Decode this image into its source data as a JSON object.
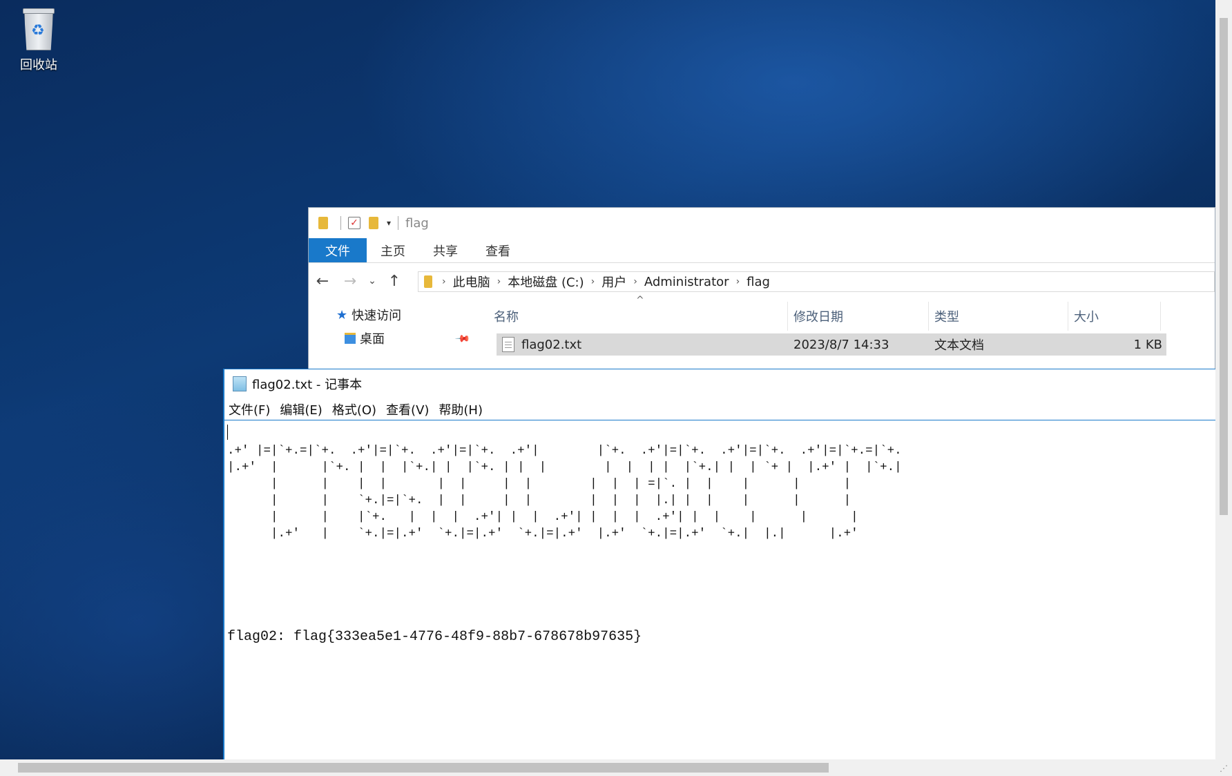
{
  "desktop": {
    "recycle_bin_label": "回收站"
  },
  "explorer": {
    "title": "flag",
    "ribbon_tabs": [
      "文件",
      "主页",
      "共享",
      "查看"
    ],
    "breadcrumb": [
      "此电脑",
      "本地磁盘 (C:)",
      "用户",
      "Administrator",
      "flag"
    ],
    "nav": {
      "quick_access": "快速访问",
      "desktop": "桌面"
    },
    "columns": [
      "名称",
      "修改日期",
      "类型",
      "大小"
    ],
    "files": [
      {
        "name": "flag02.txt",
        "modified": "2023/8/7 14:33",
        "type": "文本文档",
        "size": "1 KB"
      }
    ]
  },
  "notepad": {
    "title": "flag02.txt - 记事本",
    "menu": [
      "文件(F)",
      "编辑(E)",
      "格式(O)",
      "查看(V)",
      "帮助(H)"
    ],
    "ascii_art": ".+' |=|`+.=|`+.  .+'|=|`+.  .+'|=|`+.  .+'|        |`+.  .+'|=|`+.  .+'|=|`+.  .+'|=|`+.=|`+.\n|.+'  |      |`+. |  |  |`+.| |  |`+. | |  |        |  |  | |  |`+.| |  | `+ |  |.+' |  |`+.|\n      |      |    |  |       |  |     |  |        |  |  | =|`. |  |    |      |      |\n      |      |    `+.|=|`+.  |  |     |  |        |  |  |  |.| |  |    |      |      |\n      |      |    |`+.   |  |  |  .+'| |  |  .+'| |  |  |  .+'| |  |    |      |      |\n      |.+'   |    `+.|=|.+'  `+.|=|.+'  `+.|=|.+'  |.+'  `+.|=|.+'  `+.|  |.|      |.+'",
    "flag_line": "flag02: flag{333ea5e1-4776-48f9-88b7-678678b97635}"
  }
}
